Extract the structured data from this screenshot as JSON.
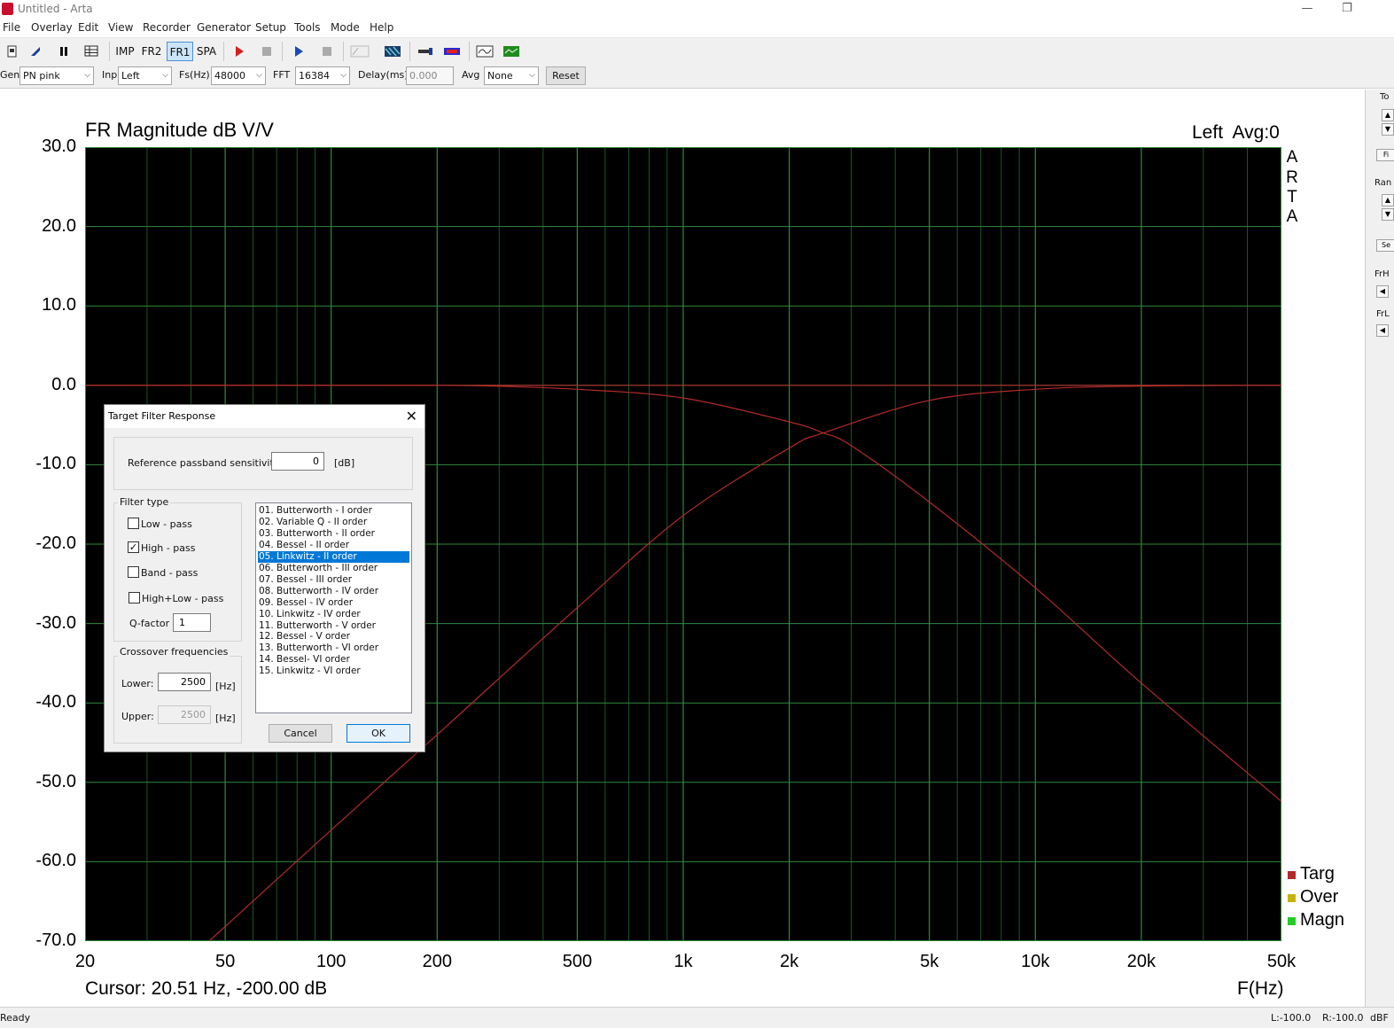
{
  "window": {
    "title": "Untitled - Arta",
    "minimize": "—",
    "restore": "❐"
  },
  "menu": [
    "File",
    "Overlay",
    "Edit",
    "View",
    "Recorder",
    "Generator",
    "Setup",
    "Tools",
    "Mode",
    "Help"
  ],
  "toolbar": {
    "imp": "IMP",
    "fr2": "FR2",
    "fr1": "FR1",
    "spa": "SPA",
    "active": "FR1"
  },
  "controls": {
    "gen_label": "Gen",
    "gen_value": "PN pink",
    "inp_label": "Inp",
    "inp_value": "Left",
    "fs_label": "Fs(Hz)",
    "fs_value": "48000",
    "fft_label": "FFT",
    "fft_value": "16384",
    "delay_label": "Delay(ms)",
    "delay_value": "0.000",
    "avg_label": "Avg",
    "avg_value": "None",
    "reset": "Reset"
  },
  "right_panel": {
    "to": "To",
    "fi": "Fi",
    "ran": "Ran",
    "se": "Se",
    "frh": "FrH",
    "frl": "FrL"
  },
  "plot": {
    "title": "FR Magnitude dB V/V",
    "channel_info": "Left  Avg:0",
    "side_letters": [
      "A",
      "R",
      "T",
      "A"
    ],
    "cursor": "Cursor: 20.51 Hz, -200.00 dB",
    "xunit": "F(Hz)",
    "legend": [
      {
        "label": "Targ",
        "color": "#b22a2a"
      },
      {
        "label": "Over",
        "color": "#c8b400"
      },
      {
        "label": "Magn",
        "color": "#22cc22"
      }
    ]
  },
  "chart_data": {
    "type": "line",
    "title": "FR Magnitude dB V/V",
    "xlabel": "F(Hz)",
    "ylabel": "",
    "xscale": "log",
    "xlim": [
      20,
      50000
    ],
    "ylim": [
      -70,
      30
    ],
    "x_tick_values": [
      20,
      50,
      100,
      200,
      500,
      1000,
      2000,
      5000,
      10000,
      20000,
      50000
    ],
    "x_tick_labels": [
      "20",
      "50",
      "100",
      "200",
      "500",
      "1k",
      "2k",
      "5k",
      "10k",
      "20k",
      "50k"
    ],
    "y_tick_values": [
      30,
      20,
      10,
      0,
      -10,
      -20,
      -30,
      -40,
      -50,
      -60,
      -70
    ],
    "y_tick_labels": [
      "30.0",
      "20.0",
      "10.0",
      "0.0",
      "-10.0",
      "-20.0",
      "-30.0",
      "-40.0",
      "-50.0",
      "-60.0",
      "-70.0"
    ],
    "grid": true,
    "background": "#000000",
    "grid_color": "#1f5f2a",
    "series": [
      {
        "name": "Targ",
        "kind": "reference",
        "color": "#b22a2a",
        "x": [
          20,
          50000
        ],
        "y": [
          0,
          0
        ]
      },
      {
        "name": "Targ",
        "kind": "high-pass",
        "color": "#b22a2a",
        "x": [
          45,
          100,
          200,
          500,
          1000,
          2000,
          2500,
          5000,
          10000,
          20000,
          50000
        ],
        "y": [
          -70,
          -56,
          -44,
          -28,
          -16.4,
          -7.9,
          -6.0,
          -1.9,
          -0.5,
          -0.1,
          0
        ]
      },
      {
        "name": "Targ",
        "kind": "low-pass",
        "color": "#b22a2a",
        "x": [
          20,
          100,
          250,
          500,
          1000,
          2000,
          2500,
          3000,
          5000,
          10000,
          20000,
          50000
        ],
        "y": [
          0,
          0,
          -0.05,
          -0.5,
          -1.6,
          -4.6,
          -6.0,
          -7.6,
          -14.7,
          -25.5,
          -37.5,
          -52.4
        ]
      }
    ]
  },
  "dialog": {
    "title": "Target Filter Response",
    "close": "✕",
    "ref_label": "Reference passband sensitivity:",
    "ref_value": "0",
    "ref_unit": "[dB]",
    "filter_type_title": "Filter type",
    "types": [
      {
        "label": "Low - pass",
        "checked": false
      },
      {
        "label": "High - pass",
        "checked": true
      },
      {
        "label": "Band - pass",
        "checked": false
      },
      {
        "label": "High+Low - pass",
        "checked": false
      }
    ],
    "check_mark": "✓",
    "q_label": "Q-factor",
    "q_value": "1",
    "crossover_title": "Crossover frequencies",
    "lower_label": "Lower:",
    "lower_value": "2500",
    "upper_label": "Upper:",
    "upper_value": "2500",
    "hz_unit": "[Hz]",
    "filters": [
      "01. Butterworth - I order",
      "02. Variable Q - II order",
      "03. Butterworth - II order",
      "04. Bessel - II order",
      "05. Linkwitz - II order",
      "06. Butterworth - III order",
      "07. Bessel - III order",
      "08. Butterworth - IV order",
      "09. Bessel - IV order",
      "10. Linkwitz - IV order",
      "11. Butterworth - V order",
      "12. Bessel - V order",
      "13. Butterworth - VI order",
      "14. Bessel- VI order",
      "15. Linkwitz - VI order"
    ],
    "selected_filter": 4,
    "cancel": "Cancel",
    "ok": "OK"
  },
  "status": {
    "left": "Ready",
    "l": "L:-100.0",
    "r": "R:-100.0",
    "dbf": "dBF"
  }
}
